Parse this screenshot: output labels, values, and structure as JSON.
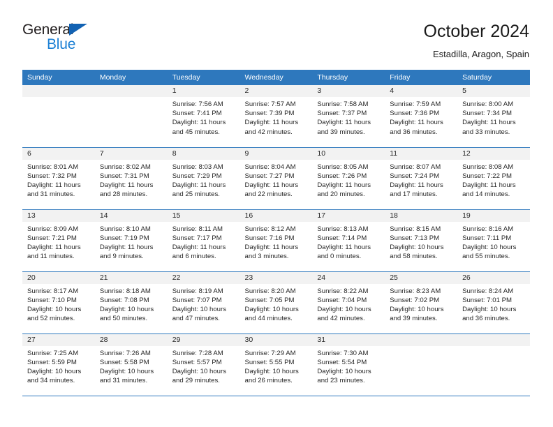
{
  "brand": {
    "name_top": "General",
    "name_bottom": "Blue",
    "triangle_color": "#1262b3",
    "blue_text_color": "#1b7fd4"
  },
  "header": {
    "title": "October 2024",
    "subtitle": "Estadilla, Aragon, Spain"
  },
  "theme": {
    "header_blue": "#2e78bd",
    "daynum_band": "#f2f2f2",
    "text": "#262626"
  },
  "weekday_headers": [
    "Sunday",
    "Monday",
    "Tuesday",
    "Wednesday",
    "Thursday",
    "Friday",
    "Saturday"
  ],
  "labels": {
    "sunrise_prefix": "Sunrise:",
    "sunset_prefix": "Sunset:",
    "daylight_prefix": "Daylight:"
  },
  "weeks": [
    [
      {
        "empty": true
      },
      {
        "empty": true
      },
      {
        "day": "1",
        "sunrise": "Sunrise: 7:56 AM",
        "sunset": "Sunset: 7:41 PM",
        "daylight_1": "Daylight: 11 hours",
        "daylight_2": "and 45 minutes."
      },
      {
        "day": "2",
        "sunrise": "Sunrise: 7:57 AM",
        "sunset": "Sunset: 7:39 PM",
        "daylight_1": "Daylight: 11 hours",
        "daylight_2": "and 42 minutes."
      },
      {
        "day": "3",
        "sunrise": "Sunrise: 7:58 AM",
        "sunset": "Sunset: 7:37 PM",
        "daylight_1": "Daylight: 11 hours",
        "daylight_2": "and 39 minutes."
      },
      {
        "day": "4",
        "sunrise": "Sunrise: 7:59 AM",
        "sunset": "Sunset: 7:36 PM",
        "daylight_1": "Daylight: 11 hours",
        "daylight_2": "and 36 minutes."
      },
      {
        "day": "5",
        "sunrise": "Sunrise: 8:00 AM",
        "sunset": "Sunset: 7:34 PM",
        "daylight_1": "Daylight: 11 hours",
        "daylight_2": "and 33 minutes."
      }
    ],
    [
      {
        "day": "6",
        "sunrise": "Sunrise: 8:01 AM",
        "sunset": "Sunset: 7:32 PM",
        "daylight_1": "Daylight: 11 hours",
        "daylight_2": "and 31 minutes."
      },
      {
        "day": "7",
        "sunrise": "Sunrise: 8:02 AM",
        "sunset": "Sunset: 7:31 PM",
        "daylight_1": "Daylight: 11 hours",
        "daylight_2": "and 28 minutes."
      },
      {
        "day": "8",
        "sunrise": "Sunrise: 8:03 AM",
        "sunset": "Sunset: 7:29 PM",
        "daylight_1": "Daylight: 11 hours",
        "daylight_2": "and 25 minutes."
      },
      {
        "day": "9",
        "sunrise": "Sunrise: 8:04 AM",
        "sunset": "Sunset: 7:27 PM",
        "daylight_1": "Daylight: 11 hours",
        "daylight_2": "and 22 minutes."
      },
      {
        "day": "10",
        "sunrise": "Sunrise: 8:05 AM",
        "sunset": "Sunset: 7:26 PM",
        "daylight_1": "Daylight: 11 hours",
        "daylight_2": "and 20 minutes."
      },
      {
        "day": "11",
        "sunrise": "Sunrise: 8:07 AM",
        "sunset": "Sunset: 7:24 PM",
        "daylight_1": "Daylight: 11 hours",
        "daylight_2": "and 17 minutes."
      },
      {
        "day": "12",
        "sunrise": "Sunrise: 8:08 AM",
        "sunset": "Sunset: 7:22 PM",
        "daylight_1": "Daylight: 11 hours",
        "daylight_2": "and 14 minutes."
      }
    ],
    [
      {
        "day": "13",
        "sunrise": "Sunrise: 8:09 AM",
        "sunset": "Sunset: 7:21 PM",
        "daylight_1": "Daylight: 11 hours",
        "daylight_2": "and 11 minutes."
      },
      {
        "day": "14",
        "sunrise": "Sunrise: 8:10 AM",
        "sunset": "Sunset: 7:19 PM",
        "daylight_1": "Daylight: 11 hours",
        "daylight_2": "and 9 minutes."
      },
      {
        "day": "15",
        "sunrise": "Sunrise: 8:11 AM",
        "sunset": "Sunset: 7:17 PM",
        "daylight_1": "Daylight: 11 hours",
        "daylight_2": "and 6 minutes."
      },
      {
        "day": "16",
        "sunrise": "Sunrise: 8:12 AM",
        "sunset": "Sunset: 7:16 PM",
        "daylight_1": "Daylight: 11 hours",
        "daylight_2": "and 3 minutes."
      },
      {
        "day": "17",
        "sunrise": "Sunrise: 8:13 AM",
        "sunset": "Sunset: 7:14 PM",
        "daylight_1": "Daylight: 11 hours",
        "daylight_2": "and 0 minutes."
      },
      {
        "day": "18",
        "sunrise": "Sunrise: 8:15 AM",
        "sunset": "Sunset: 7:13 PM",
        "daylight_1": "Daylight: 10 hours",
        "daylight_2": "and 58 minutes."
      },
      {
        "day": "19",
        "sunrise": "Sunrise: 8:16 AM",
        "sunset": "Sunset: 7:11 PM",
        "daylight_1": "Daylight: 10 hours",
        "daylight_2": "and 55 minutes."
      }
    ],
    [
      {
        "day": "20",
        "sunrise": "Sunrise: 8:17 AM",
        "sunset": "Sunset: 7:10 PM",
        "daylight_1": "Daylight: 10 hours",
        "daylight_2": "and 52 minutes."
      },
      {
        "day": "21",
        "sunrise": "Sunrise: 8:18 AM",
        "sunset": "Sunset: 7:08 PM",
        "daylight_1": "Daylight: 10 hours",
        "daylight_2": "and 50 minutes."
      },
      {
        "day": "22",
        "sunrise": "Sunrise: 8:19 AM",
        "sunset": "Sunset: 7:07 PM",
        "daylight_1": "Daylight: 10 hours",
        "daylight_2": "and 47 minutes."
      },
      {
        "day": "23",
        "sunrise": "Sunrise: 8:20 AM",
        "sunset": "Sunset: 7:05 PM",
        "daylight_1": "Daylight: 10 hours",
        "daylight_2": "and 44 minutes."
      },
      {
        "day": "24",
        "sunrise": "Sunrise: 8:22 AM",
        "sunset": "Sunset: 7:04 PM",
        "daylight_1": "Daylight: 10 hours",
        "daylight_2": "and 42 minutes."
      },
      {
        "day": "25",
        "sunrise": "Sunrise: 8:23 AM",
        "sunset": "Sunset: 7:02 PM",
        "daylight_1": "Daylight: 10 hours",
        "daylight_2": "and 39 minutes."
      },
      {
        "day": "26",
        "sunrise": "Sunrise: 8:24 AM",
        "sunset": "Sunset: 7:01 PM",
        "daylight_1": "Daylight: 10 hours",
        "daylight_2": "and 36 minutes."
      }
    ],
    [
      {
        "day": "27",
        "sunrise": "Sunrise: 7:25 AM",
        "sunset": "Sunset: 5:59 PM",
        "daylight_1": "Daylight: 10 hours",
        "daylight_2": "and 34 minutes."
      },
      {
        "day": "28",
        "sunrise": "Sunrise: 7:26 AM",
        "sunset": "Sunset: 5:58 PM",
        "daylight_1": "Daylight: 10 hours",
        "daylight_2": "and 31 minutes."
      },
      {
        "day": "29",
        "sunrise": "Sunrise: 7:28 AM",
        "sunset": "Sunset: 5:57 PM",
        "daylight_1": "Daylight: 10 hours",
        "daylight_2": "and 29 minutes."
      },
      {
        "day": "30",
        "sunrise": "Sunrise: 7:29 AM",
        "sunset": "Sunset: 5:55 PM",
        "daylight_1": "Daylight: 10 hours",
        "daylight_2": "and 26 minutes."
      },
      {
        "day": "31",
        "sunrise": "Sunrise: 7:30 AM",
        "sunset": "Sunset: 5:54 PM",
        "daylight_1": "Daylight: 10 hours",
        "daylight_2": "and 23 minutes."
      },
      {
        "empty": true
      },
      {
        "empty": true
      }
    ]
  ]
}
